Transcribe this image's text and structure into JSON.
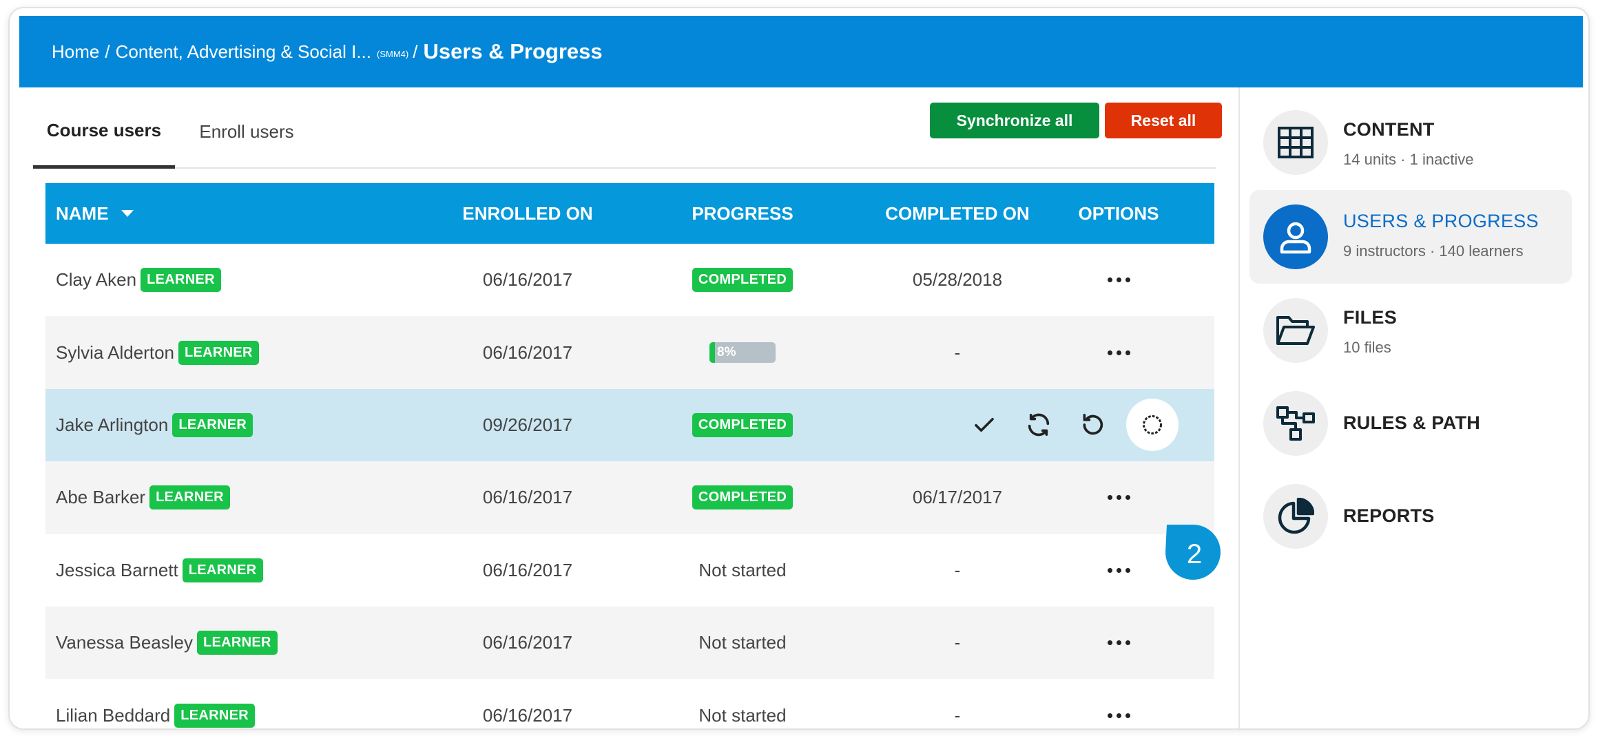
{
  "breadcrumb": {
    "home": "Home",
    "course": "Content, Advertising & Social I...",
    "course_code": "(SMM4)",
    "separator": "/",
    "current": "Users & Progress"
  },
  "tabs": [
    {
      "label": "Course users",
      "active": true
    },
    {
      "label": "Enroll users",
      "active": false
    }
  ],
  "actions": {
    "sync_label": "Synchronize all",
    "reset_label": "Reset all"
  },
  "table": {
    "headers": {
      "name": "NAME",
      "enrolled": "ENROLLED ON",
      "progress": "PROGRESS",
      "completed": "COMPLETED ON",
      "options": "OPTIONS"
    },
    "role_label": "LEARNER",
    "completed_label": "COMPLETED",
    "rows": [
      {
        "name": "Clay Aken",
        "enrolled": "06/16/2017",
        "progress": "COMPLETED",
        "completed": "05/28/2018"
      },
      {
        "name": "Sylvia Alderton",
        "enrolled": "06/16/2017",
        "progress": "8%",
        "progress_value": 0.08,
        "completed": "-"
      },
      {
        "name": "Jake Arlington",
        "enrolled": "09/26/2017",
        "progress": "COMPLETED",
        "completed": ""
      },
      {
        "name": "Abe Barker",
        "enrolled": "06/16/2017",
        "progress": "COMPLETED",
        "completed": "06/17/2017"
      },
      {
        "name": "Jessica Barnett",
        "enrolled": "06/16/2017",
        "progress": "Not started",
        "completed": "-"
      },
      {
        "name": "Vanessa Beasley",
        "enrolled": "06/16/2017",
        "progress": "Not started",
        "completed": "-"
      },
      {
        "name": "Lilian Beddard",
        "enrolled": "06/16/2017",
        "progress": "Not started",
        "completed": "-"
      }
    ]
  },
  "callout": {
    "number": "2"
  },
  "sidebar": {
    "items": [
      {
        "title": "CONTENT",
        "subtitle": "14 units · 1 inactive",
        "icon": "grid-icon"
      },
      {
        "title": "USERS & PROGRESS",
        "subtitle": "9 instructors · 140 learners",
        "icon": "user-icon",
        "active": true
      },
      {
        "title": "FILES",
        "subtitle": "10 files",
        "icon": "folder-icon"
      },
      {
        "title": "RULES & PATH",
        "subtitle": "",
        "icon": "flow-icon"
      },
      {
        "title": "REPORTS",
        "subtitle": "",
        "icon": "pie-chart-icon"
      }
    ]
  },
  "colors": {
    "header": "#0487d9",
    "table_header": "#0598db",
    "learner_badge": "#19c249",
    "sync_button": "#078f3e",
    "reset_button": "#e03207",
    "highlight_row": "#cde7f2",
    "sidebar_active": "#0a6dc8"
  }
}
